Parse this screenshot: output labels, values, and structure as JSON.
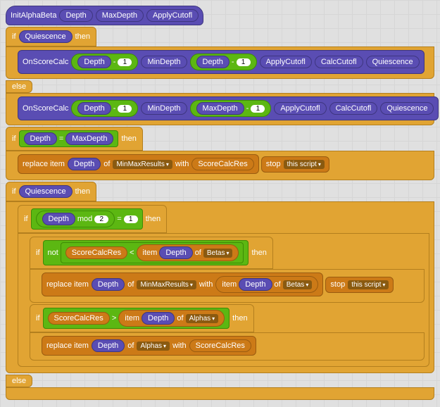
{
  "hat": {
    "name": "InitAlphaBeta",
    "args": [
      "Depth",
      "MaxDepth",
      "ApplyCutofl"
    ]
  },
  "kw": {
    "if": "if",
    "then": "then",
    "else": "else",
    "replace": "replace  item",
    "of": "of",
    "with": "with",
    "stop": "stop",
    "this_script": "this script",
    "not": "not",
    "item": "item",
    "mod": "mod"
  },
  "vars": {
    "Quiescence": "Quiescence",
    "Depth": "Depth",
    "MaxDepth": "MaxDepth",
    "MinDepth": "MinDepth",
    "ApplyCutofl": "ApplyCutofl",
    "CalcCutofl": "CalcCutofl",
    "ScoreCalcRes": "ScoreCalcRes",
    "OnScoreCalc": "OnScoreCalc"
  },
  "lists": {
    "MinMaxResults": "MinMaxResults",
    "Betas": "Betas",
    "Alphas": "Alphas"
  },
  "lits": {
    "one": "1",
    "two": "2"
  },
  "ops": {
    "minus": "-",
    "eq": "=",
    "lt": "<",
    "gt": ">"
  }
}
